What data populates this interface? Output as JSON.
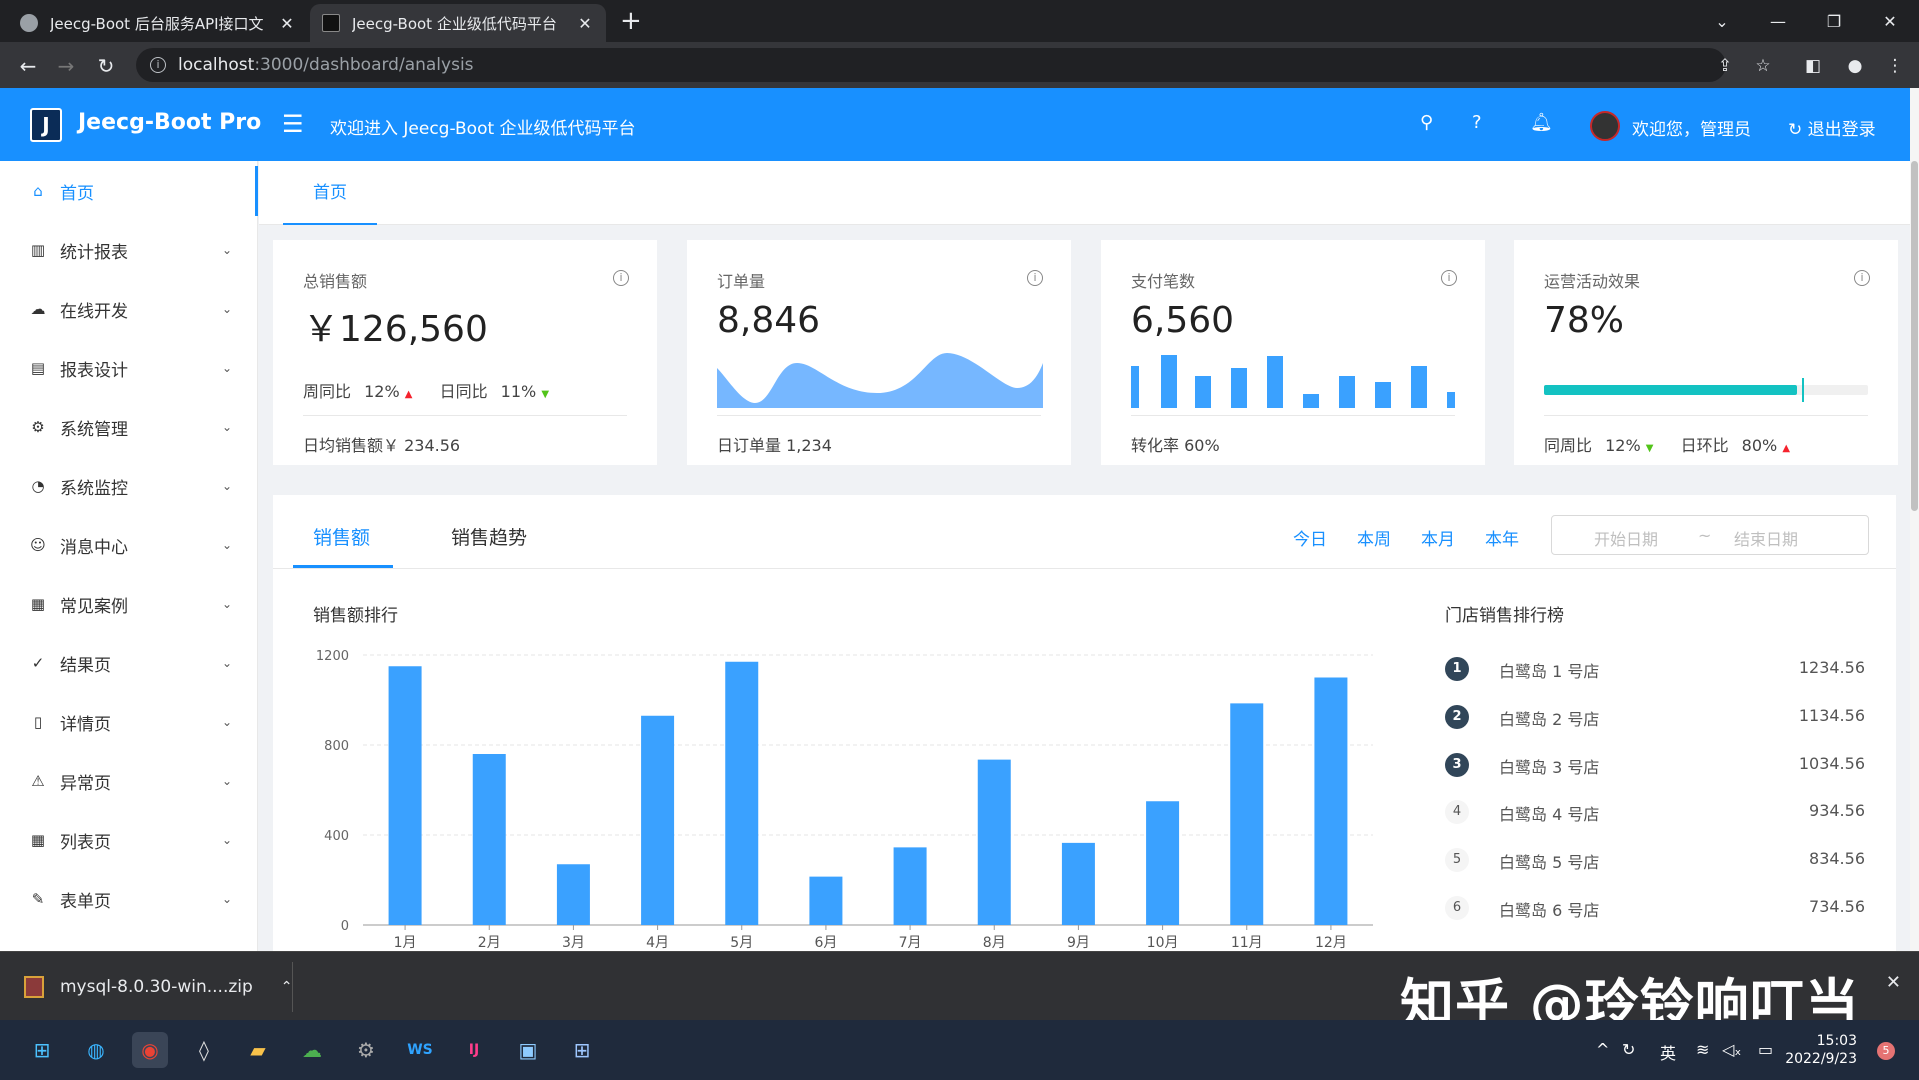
{
  "browser": {
    "tabs": [
      {
        "title": "Jeecg-Boot 后台服务API接口文",
        "close": "✕"
      },
      {
        "title": "Jeecg-Boot 企业级低代码平台",
        "close": "✕"
      }
    ],
    "new_tab": "+",
    "url_host": "localhost",
    "url_path": ":3000/dashboard/analysis"
  },
  "header": {
    "brand": "Jeecg-Boot Pro",
    "logo_letter": "J",
    "welcome": "欢迎进入 Jeecg-Boot 企业级低代码平台",
    "user_greeting": "欢迎您，管理员",
    "logout": "退出登录"
  },
  "sidebar": {
    "items": [
      {
        "label": "首页",
        "icon": "⌂"
      },
      {
        "label": "统计报表",
        "icon": "▥"
      },
      {
        "label": "在线开发",
        "icon": "☁"
      },
      {
        "label": "报表设计",
        "icon": "▤"
      },
      {
        "label": "系统管理",
        "icon": "⚙"
      },
      {
        "label": "系统监控",
        "icon": "◔"
      },
      {
        "label": "消息中心",
        "icon": "☺"
      },
      {
        "label": "常见案例",
        "icon": "▦"
      },
      {
        "label": "结果页",
        "icon": "✓"
      },
      {
        "label": "详情页",
        "icon": "▯"
      },
      {
        "label": "异常页",
        "icon": "⚠"
      },
      {
        "label": "列表页",
        "icon": "▦"
      },
      {
        "label": "表单页",
        "icon": "✎"
      }
    ]
  },
  "page_tabs": {
    "home": "首页"
  },
  "cards": {
    "sales": {
      "title": "总销售额",
      "value": "￥126,560",
      "wow_label": "周同比",
      "wow": "12%",
      "dod_label": "日同比",
      "dod": "11%",
      "footer": "日均销售额￥ 234.56"
    },
    "orders": {
      "title": "订单量",
      "value": "8,846",
      "footer": "日订单量 1,234"
    },
    "payments": {
      "title": "支付笔数",
      "value": "6,560",
      "footer": "转化率 60%"
    },
    "ops": {
      "title": "运营活动效果",
      "value": "78%",
      "progress": 0.78,
      "yoy_label": "同周比",
      "yoy": "12%",
      "mom_label": "日环比",
      "mom": "80%"
    }
  },
  "panel": {
    "tab_sales": "销售额",
    "tab_trend": "销售趋势",
    "range": {
      "today": "今日",
      "week": "本周",
      "month": "本月",
      "year": "本年"
    },
    "date_start": "开始日期",
    "date_sep": "~",
    "date_end": "结束日期",
    "chart_title": "销售额排行",
    "rank_title": "门店销售排行榜",
    "ranking": [
      {
        "num": "1",
        "name": "白鹭岛 1 号店",
        "value": "1234.56"
      },
      {
        "num": "2",
        "name": "白鹭岛 2 号店",
        "value": "1134.56"
      },
      {
        "num": "3",
        "name": "白鹭岛 3 号店",
        "value": "1034.56"
      },
      {
        "num": "4",
        "name": "白鹭岛 4 号店",
        "value": "934.56"
      },
      {
        "num": "5",
        "name": "白鹭岛 5 号店",
        "value": "834.56"
      },
      {
        "num": "6",
        "name": "白鹭岛 6 号店",
        "value": "734.56"
      }
    ]
  },
  "chart_data": {
    "type": "bar",
    "categories": [
      "1月",
      "2月",
      "3月",
      "4月",
      "5月",
      "6月",
      "7月",
      "8月",
      "9月",
      "10月",
      "11月",
      "12月"
    ],
    "values": [
      1150,
      760,
      270,
      930,
      1170,
      215,
      345,
      735,
      365,
      550,
      985,
      1100
    ],
    "yticks": [
      0,
      400,
      800,
      1200
    ],
    "ylim": [
      0,
      1200
    ],
    "color": "#3aa1ff",
    "grid": true
  },
  "download": {
    "filename": "mysql-8.0.30-win....zip"
  },
  "watermark": "知乎 @玲铃响叮当",
  "taskbar": {
    "ime": "英",
    "time": "15:03",
    "date": "2022/9/23",
    "notifications": "5"
  }
}
